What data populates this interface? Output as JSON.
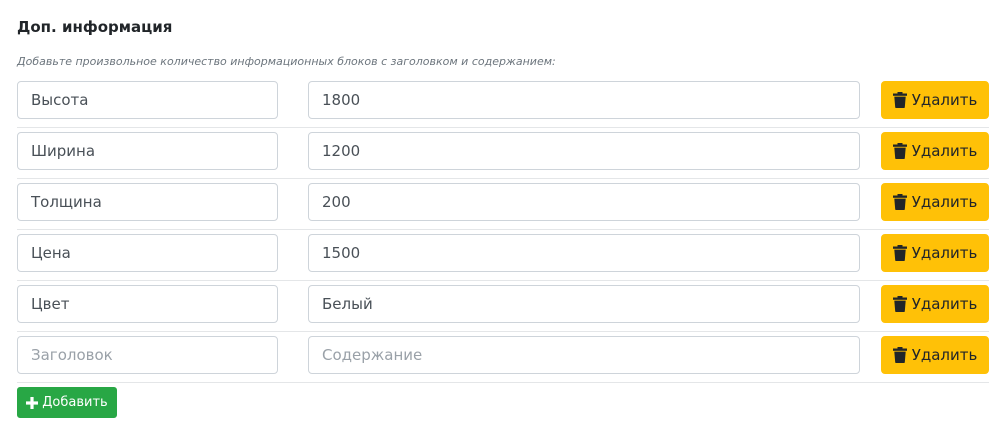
{
  "section": {
    "title": "Доп. информация",
    "hint": "Добавьте произвольное количество информационных блоков с заголовком и содержанием:"
  },
  "rows": [
    {
      "title": "Высота",
      "content": "1800",
      "title_placeholder": "Заголовок",
      "content_placeholder": "Содержание",
      "delete_label": "Удалить"
    },
    {
      "title": "Ширина",
      "content": "1200",
      "title_placeholder": "Заголовок",
      "content_placeholder": "Содержание",
      "delete_label": "Удалить"
    },
    {
      "title": "Толщина",
      "content": "200",
      "title_placeholder": "Заголовок",
      "content_placeholder": "Содержание",
      "delete_label": "Удалить"
    },
    {
      "title": "Цена",
      "content": "1500",
      "title_placeholder": "Заголовок",
      "content_placeholder": "Содержание",
      "delete_label": "Удалить"
    },
    {
      "title": "Цвет",
      "content": "Белый",
      "title_placeholder": "Заголовок",
      "content_placeholder": "Содержание",
      "delete_label": "Удалить"
    },
    {
      "title": "",
      "content": "",
      "title_placeholder": "Заголовок",
      "content_placeholder": "Содержание",
      "delete_label": "Удалить"
    }
  ],
  "add_button": {
    "label": "Добавить"
  },
  "icons": {
    "delete": "trash-icon",
    "add": "plus-icon"
  },
  "colors": {
    "delete_button": "#ffc107",
    "add_button": "#28a745"
  }
}
